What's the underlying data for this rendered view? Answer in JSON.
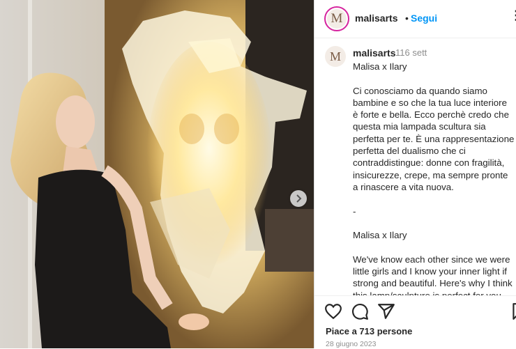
{
  "post": {
    "header": {
      "username": "malisarts",
      "separator": "•",
      "follow_label": "Segui",
      "more_label": "⋮",
      "avatar_letter": "M"
    },
    "caption": {
      "username": "malisarts",
      "time_ago": "116 sett",
      "avatar_letter": "M",
      "text": "Malisa x Ilary\n\nCi conosciamo da quando siamo bambine e so che la tua luce interiore è forte e bella. Ecco perchè credo che questa mia lampada scultura sia perfetta per te. È una rappresentazione perfetta del dualismo che ci contraddistingue: donne con fragilità, insicurezze, crepe, ma sempre pronte a rinascere a vita nuova.\n\n-\n\nMalisa x Ilary\n\nWe've know each other since we were little girls and I know your inner light if strong and beautiful. Here's why I think this lamp/sculpture is perfect for you."
    },
    "actions": {
      "icons": [
        "heart-icon",
        "comment-icon",
        "share-icon",
        "bookmark-icon"
      ]
    },
    "likes_text": "Piace a 713 persone",
    "date_text": "28 giugno 2023",
    "colors": {
      "follow": "#0095f6",
      "text": "#262626",
      "muted": "#8e8e8e",
      "story_ring": "#d6249f"
    }
  }
}
